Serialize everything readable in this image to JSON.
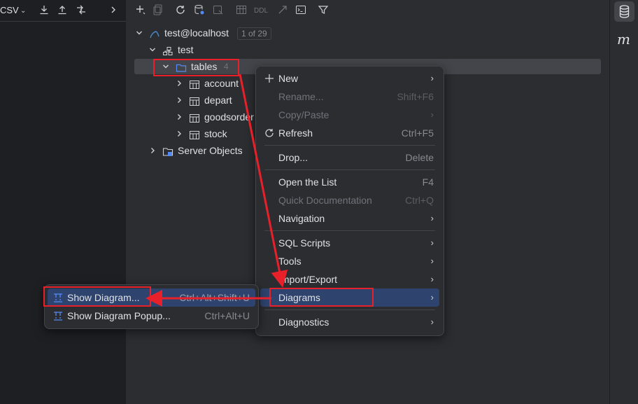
{
  "left_toolbar": {
    "format": "CSV"
  },
  "tree": {
    "connection": {
      "label": "test@localhost",
      "badge": "1 of 29"
    },
    "schema": {
      "label": "test"
    },
    "tables_folder": {
      "label": "tables",
      "count": "4"
    },
    "tables": [
      "account",
      "depart",
      "goodsorder",
      "stock"
    ],
    "server_objects": {
      "label": "Server Objects"
    }
  },
  "toolbar": {
    "ddl_label": "DDL"
  },
  "context_menu": {
    "new": "New",
    "rename": "Rename...",
    "rename_shortcut": "Shift+F6",
    "copy_paste": "Copy/Paste",
    "refresh": "Refresh",
    "refresh_shortcut": "Ctrl+F5",
    "drop": "Drop...",
    "drop_shortcut": "Delete",
    "open_list": "Open the List",
    "open_list_shortcut": "F4",
    "quick_doc": "Quick Documentation",
    "quick_doc_shortcut": "Ctrl+Q",
    "navigation": "Navigation",
    "sql_scripts": "SQL Scripts",
    "tools": "Tools",
    "import_export": "Import/Export",
    "diagrams": "Diagrams",
    "diagnostics": "Diagnostics"
  },
  "submenu": {
    "show_diagram": "Show Diagram...",
    "show_diagram_shortcut": "Ctrl+Alt+Shift+U",
    "show_diagram_popup": "Show Diagram Popup...",
    "show_diagram_popup_shortcut": "Ctrl+Alt+U"
  },
  "right_bar": {
    "m_label": "m"
  },
  "colors": {
    "accent": "#2e436e",
    "annotation": "#e8202a",
    "folder": "#548af7"
  }
}
